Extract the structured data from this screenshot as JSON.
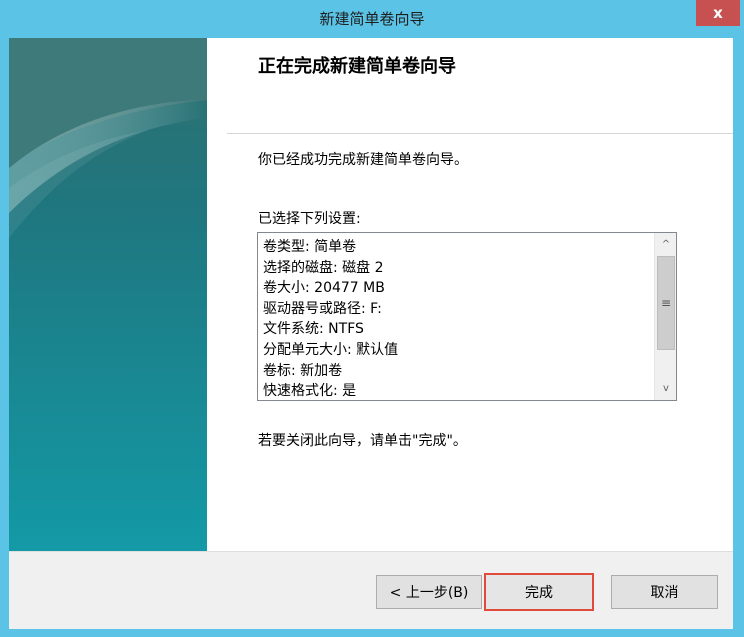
{
  "window": {
    "title": "新建简单卷向导",
    "close_glyph": "x",
    "close_color": "#c75050",
    "titlebar_color": "#5bc4e6"
  },
  "page": {
    "heading": "正在完成新建简单卷向导",
    "completed_text": "你已经成功完成新建简单卷向导。",
    "selected_label": "已选择下列设置:",
    "settings": [
      "卷类型: 简单卷",
      "选择的磁盘: 磁盘 2",
      "卷大小: 20477 MB",
      "驱动器号或路径: F:",
      "文件系统: NTFS",
      "分配单元大小: 默认值",
      "卷标: 新加卷",
      "快速格式化: 是"
    ],
    "close_hint": "若要关闭此向导，请单击\"完成\"。"
  },
  "buttons": {
    "back": "< 上一步(B)",
    "finish": "完成",
    "cancel": "取消"
  },
  "scrollbar": {
    "up_glyph": "^",
    "down_glyph": "v",
    "grip_glyph": "≡"
  },
  "colors": {
    "banner_teal": "#1b8b96",
    "highlight_border": "#e04a3c"
  }
}
